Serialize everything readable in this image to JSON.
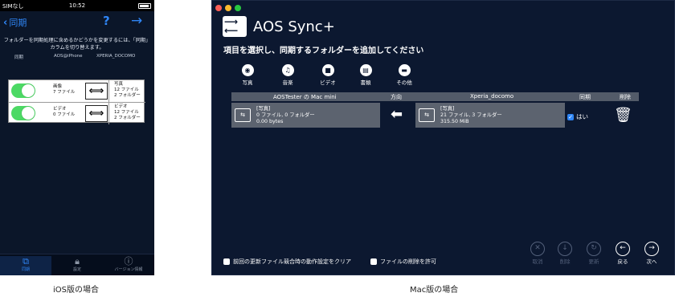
{
  "ios": {
    "status": {
      "carrier": "SIMなし",
      "time": "10:52"
    },
    "nav": {
      "back_label": "同期",
      "help_label": "?",
      "next_label": "→"
    },
    "hint": "フォルダーを同期処理に含めるかどうかを変更するには、「同期」カラムを切り替えます。",
    "columns": {
      "sync": "同期",
      "device": "AOS@iPhone",
      "target": "XPERIA_DOCOMO"
    },
    "rows": [
      {
        "left_name": "画像",
        "left_count": "7 ファイル",
        "right_name": "写真",
        "right_files": "12 ファイル",
        "right_folders": "2 フォルダー"
      },
      {
        "left_name": "ビデオ",
        "left_count": "0 ファイル",
        "right_name": "ビデオ",
        "right_files": "12 ファイル",
        "right_folders": "2 フォルダー"
      }
    ],
    "tabs": [
      {
        "label": "同期"
      },
      {
        "label": "設定"
      },
      {
        "label": "バージョン情報"
      }
    ],
    "caption": "iOS版の場合"
  },
  "mac": {
    "title": "AOS Sync+",
    "subtitle": "項目を選択し、同期するフォルダーを追加してください",
    "categories": [
      {
        "label": "写真"
      },
      {
        "label": "音楽"
      },
      {
        "label": "ビデオ"
      },
      {
        "label": "書類"
      },
      {
        "label": "その他"
      }
    ],
    "table_headers": {
      "left": "AOSTester の Mac mini",
      "direction": "方向",
      "right": "Xperia_docomo",
      "sync": "同期",
      "delete": "削除"
    },
    "left_folder": {
      "name": "[写真]",
      "summary": "0 ファイル, 0 フォルダー",
      "size": "0.00 bytes"
    },
    "right_folder": {
      "name": "[写真]",
      "summary": "21 ファイル, 3 フォルダー",
      "size": "315.50 MiB"
    },
    "sync_value": "はい",
    "footer": {
      "clear_label": "前回の更新ファイル競合時の動作設定をクリア",
      "allow_delete_label": "ファイルの削除を許可"
    },
    "buttons": [
      {
        "label": "取消"
      },
      {
        "label": "削除"
      },
      {
        "label": "更新"
      },
      {
        "label": "戻る"
      },
      {
        "label": "次へ"
      }
    ],
    "caption": "Mac版の場合"
  },
  "colors": {
    "accent_blue": "#2f86f6",
    "toggle_green": "#4cd964",
    "panel_bg": "#0c1830"
  }
}
